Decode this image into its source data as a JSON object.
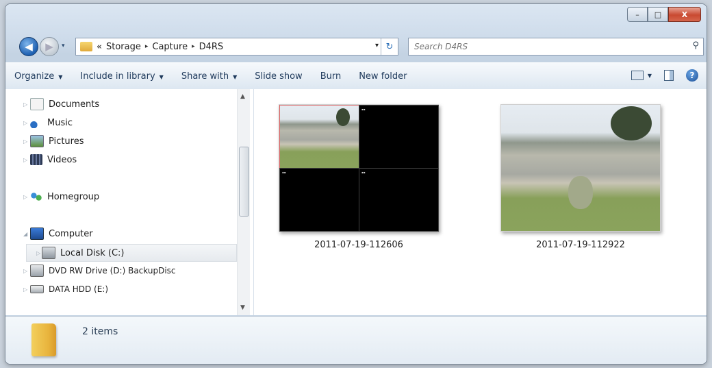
{
  "window": {
    "controls": {
      "minimize": "–",
      "maximize": "□",
      "close": "X"
    }
  },
  "address": {
    "overflow": "«",
    "breadcrumbs": [
      "Storage",
      "Capture",
      "D4RS"
    ],
    "separator": "▸",
    "dropdown": "▾",
    "refresh": "↻",
    "search_placeholder": "Search D4RS"
  },
  "toolbar": {
    "items": [
      {
        "label": "Organize",
        "dropdown": true
      },
      {
        "label": "Include in library",
        "dropdown": true
      },
      {
        "label": "Share with",
        "dropdown": true
      },
      {
        "label": "Slide show",
        "dropdown": false
      },
      {
        "label": "Burn",
        "dropdown": false
      },
      {
        "label": "New folder",
        "dropdown": false
      }
    ],
    "dropdown_glyph": "▼",
    "help_label": "?"
  },
  "navpane": {
    "items": [
      {
        "label": "Documents",
        "icon": "documents-icon"
      },
      {
        "label": "Music",
        "icon": "music-icon"
      },
      {
        "label": "Pictures",
        "icon": "pictures-icon"
      },
      {
        "label": "Videos",
        "icon": "videos-icon"
      },
      {
        "label": "Homegroup",
        "icon": "homegroup-icon"
      },
      {
        "label": "Computer",
        "icon": "computer-icon"
      },
      {
        "label": "Local Disk (C:)",
        "icon": "local-disk-icon",
        "selected": true
      },
      {
        "label": "DVD RW Drive (D:) BackupDisc",
        "icon": "dvd-drive-icon"
      },
      {
        "label": "DATA HDD (E:)",
        "icon": "hdd-icon"
      }
    ]
  },
  "files": [
    {
      "name": "2011-07-19-112606",
      "type": "quad-view"
    },
    {
      "name": "2011-07-19-112922",
      "type": "single-view"
    }
  ],
  "status": {
    "item_count": "2 items"
  },
  "colors": {
    "accent": "#1e395b",
    "selection": "#e6eaee",
    "close": "#c94a32"
  }
}
